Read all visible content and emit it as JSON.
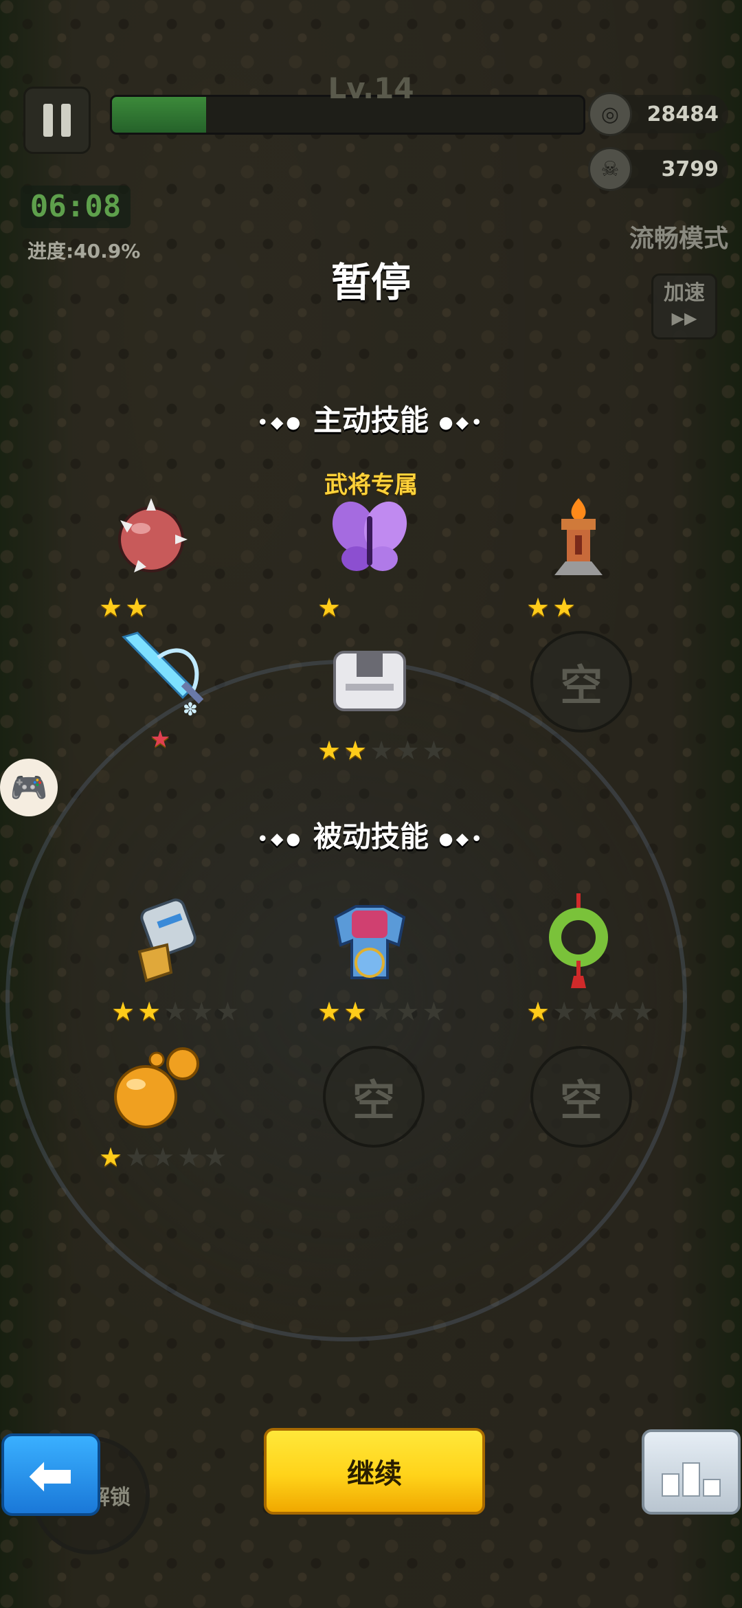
{
  "hud": {
    "level": "Lv.14",
    "xp_progress": 0.2,
    "coins": "28484",
    "coin_icon": "coin-icon",
    "kills": "3799",
    "kill_icon": "skull-icon",
    "timer": "06:08",
    "progress": "进度:40.9%",
    "mode": "流畅模式",
    "speed_label": "加速",
    "speed_arrows": "▶▶"
  },
  "pause": {
    "title": "暂停",
    "active_section": "主动技能",
    "passive_section": "被动技能",
    "exclusive_label": "武将专属",
    "empty_label": "空"
  },
  "active_skills": [
    {
      "icon": "spiked-ball-icon",
      "stars": 2,
      "max": 2
    },
    {
      "icon": "purple-butterfly-icon",
      "stars": 1,
      "max": 1
    },
    {
      "icon": "fire-tower-icon",
      "stars": 2,
      "max": 2
    },
    {
      "icon": "ice-sword-icon",
      "stars": 0,
      "max": 0
    },
    {
      "icon": "anvil-icon",
      "stars": 2,
      "max": 5
    },
    {
      "icon": "empty",
      "stars": 0,
      "max": 0
    }
  ],
  "passive_skills": [
    {
      "icon": "gauntlet-icon",
      "stars": 2,
      "max": 5
    },
    {
      "icon": "armor-icon",
      "stars": 2,
      "max": 5
    },
    {
      "icon": "jade-pendant-icon",
      "stars": 1,
      "max": 5
    },
    {
      "icon": "orange-orbs-icon",
      "stars": 1,
      "max": 5
    },
    {
      "icon": "empty",
      "stars": 0,
      "max": 0
    },
    {
      "icon": "empty",
      "stars": 0,
      "max": 0
    }
  ],
  "bottom": {
    "back_arrow": "🡄",
    "unlock_label": "解锁",
    "continue_label": "继续",
    "ranking_icon": "podium-icon"
  },
  "colors": {
    "accent_yellow": "#ffd31a",
    "timer_green": "#5ea04c",
    "exclusive_gold": "#ffd23a",
    "back_blue": "#1a78d8"
  }
}
